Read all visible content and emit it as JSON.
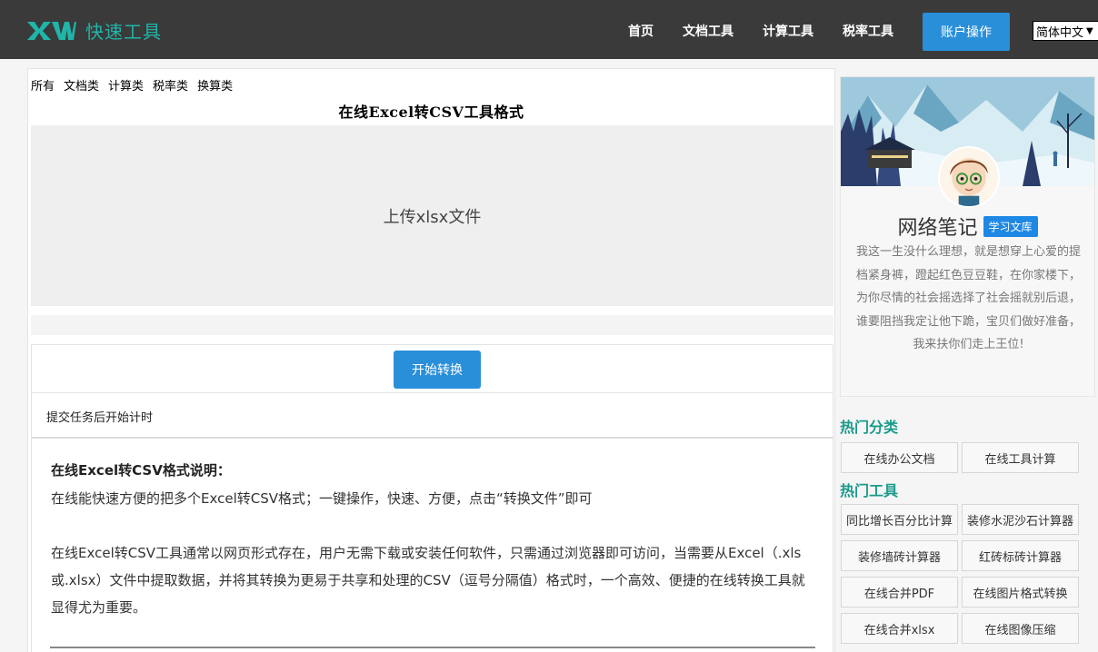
{
  "header": {
    "logo_mark": "XW",
    "logo_text": "快速工具",
    "nav": [
      "首页",
      "文档工具",
      "计算工具",
      "税率工具"
    ],
    "account_button": "账户操作",
    "language": "简体中文"
  },
  "categories": [
    "所有",
    "文档类",
    "计算类",
    "税率类",
    "换算类"
  ],
  "tool": {
    "title": "在线Excel转CSV工具格式",
    "upload_label": "上传xlsx文件",
    "start_button": "开始转换",
    "timer_text": "提交任务后开始计时"
  },
  "description": {
    "title": "在线Excel转CSV格式说明：",
    "line1": "在线能快速方便的把多个Excel转CSV格式；一键操作，快速、方便，点击“转换文件”即可",
    "paragraph2": "在线Excel转CSV工具通常以网页形式存在，用户无需下载或安装任何软件，只需通过浏览器即可访问，当需要从Excel（.xls或.xlsx）文件中提取数据，并将其转换为更易于共享和处理的CSV（逗号分隔值）格式时，一个高效、便捷的在线转换工具就显得尤为重要。"
  },
  "profile": {
    "name": "网络笔记",
    "badge": "学习文库",
    "bio": "我这一生没什么理想，就是想穿上心爱的提档紧身裤，蹬起红色豆豆鞋，在你家楼下，为你尽情的社会摇选择了社会摇就别后退，谁要阻挡我定让他下跪，宝贝们做好准备，我来扶你们走上王位!"
  },
  "hot_categories": {
    "heading": "热门分类",
    "items": [
      "在线办公文档",
      "在线工具计算"
    ]
  },
  "hot_tools": {
    "heading": "热门工具",
    "items": [
      "同比增长百分比计算",
      "装修水泥沙石计算器",
      "装修墙砖计算器",
      "红砖标砖计算器",
      "在线合并PDF",
      "在线图片格式转换",
      "在线合并xlsx",
      "在线图像压缩"
    ]
  },
  "colors": {
    "header_bg": "#3a3a3a",
    "accent_blue": "#2a8fd9",
    "logo_teal": "#1fb5a8",
    "section_teal": "#1a9a8a"
  }
}
